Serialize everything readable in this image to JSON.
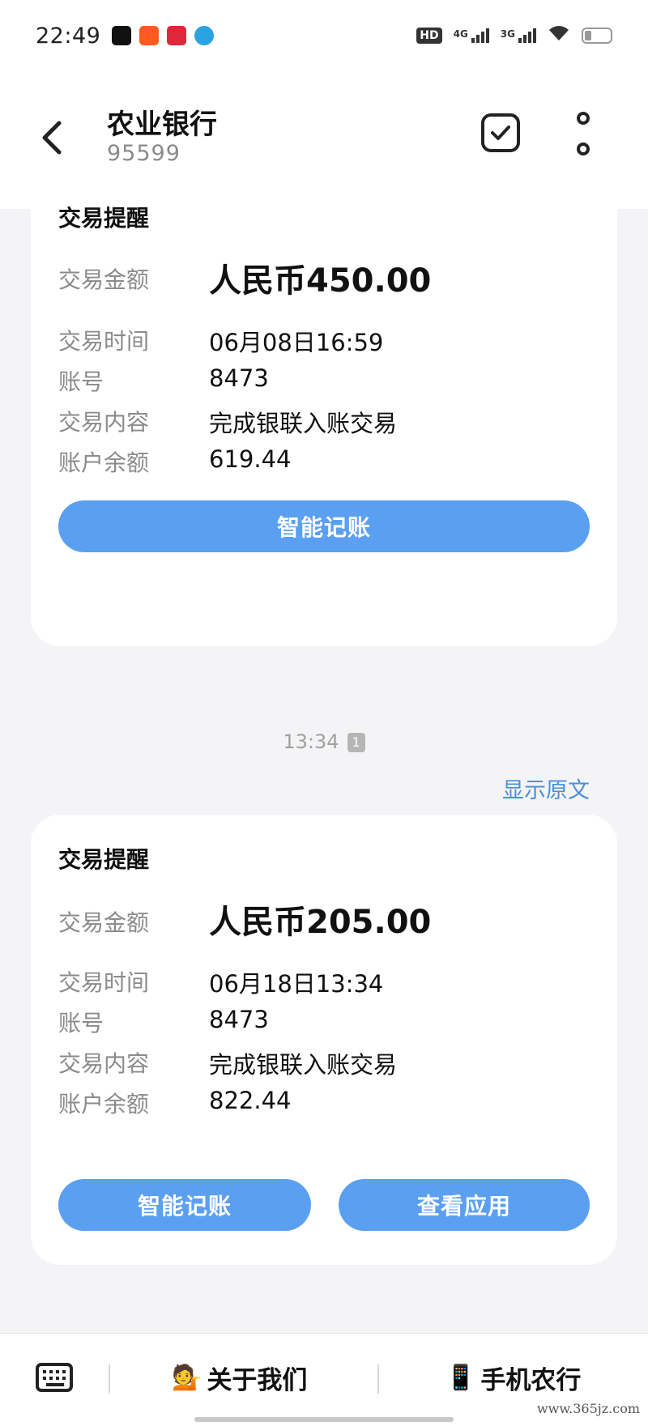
{
  "status_bar": {
    "time": "22:49",
    "hd": "HD",
    "net1": "4G",
    "net2": "3G"
  },
  "header": {
    "title": "农业银行",
    "subtitle": "95599"
  },
  "messages": [
    {
      "title": "交易提醒",
      "amount_label": "交易金额",
      "amount": "人民币450.00",
      "rows": [
        {
          "label": "交易时间",
          "value": "06月08日16:59"
        },
        {
          "label": "账号",
          "value": "8473"
        },
        {
          "label": "交易内容",
          "value": "完成银联入账交易"
        },
        {
          "label": "账户余额",
          "value": "619.44"
        }
      ],
      "buttons": [
        "智能记账"
      ]
    },
    {
      "title": "交易提醒",
      "amount_label": "交易金额",
      "amount": "人民币205.00",
      "rows": [
        {
          "label": "交易时间",
          "value": "06月18日13:34"
        },
        {
          "label": "账号",
          "value": "8473"
        },
        {
          "label": "交易内容",
          "value": "完成银联入账交易"
        },
        {
          "label": "账户余额",
          "value": "822.44"
        }
      ],
      "buttons": [
        "智能记账",
        "查看应用"
      ]
    }
  ],
  "timestamp": {
    "time": "13:34",
    "sim": "1"
  },
  "show_original": "显示原文",
  "bottom_menu": {
    "about": {
      "icon": "💁",
      "label": "关于我们"
    },
    "mobile": {
      "icon": "📱",
      "label": "手机农行"
    }
  },
  "watermark": "www.365jz.com",
  "colors": {
    "button": "#5b9ff1",
    "link": "#4a90d9",
    "background": "#f4f4f6"
  }
}
